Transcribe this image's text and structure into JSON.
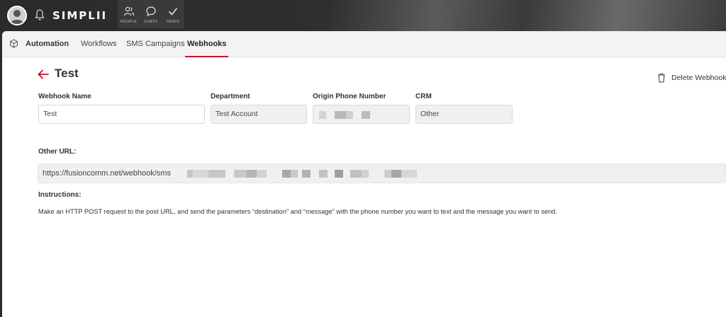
{
  "app": {
    "logo_text": "SIMPLII",
    "nav": [
      {
        "label": "PEOPLE",
        "icon": "people-icon"
      },
      {
        "label": "CHATS",
        "icon": "chat-icon"
      },
      {
        "label": "TASKS",
        "icon": "check-icon"
      }
    ]
  },
  "tabs": {
    "section": "Automation",
    "items": [
      "Workflows",
      "SMS Campaigns",
      "Webhooks"
    ],
    "active": "Webhooks"
  },
  "page": {
    "title": "Test",
    "delete_label": "Delete Webhook"
  },
  "form": {
    "webhook_name": {
      "label": "Webhook Name",
      "value": "Test"
    },
    "department": {
      "label": "Department",
      "value": "Test Account"
    },
    "origin_phone": {
      "label": "Origin Phone Number",
      "value": ""
    },
    "crm": {
      "label": "CRM",
      "value": "Other"
    },
    "other_url": {
      "label": "Other URL:",
      "value": "https://fusioncomm.net/webhook/sms"
    },
    "instructions": {
      "label": "Instructions:",
      "text": "Make an HTTP POST request to the post URL, and send the parameters “destination” and “message” with the phone number you want to text and the message you want to send."
    }
  },
  "colors": {
    "accent": "#c8102e",
    "topbar": "#2b2b2d",
    "readonly_field": "#f0f0f0"
  }
}
